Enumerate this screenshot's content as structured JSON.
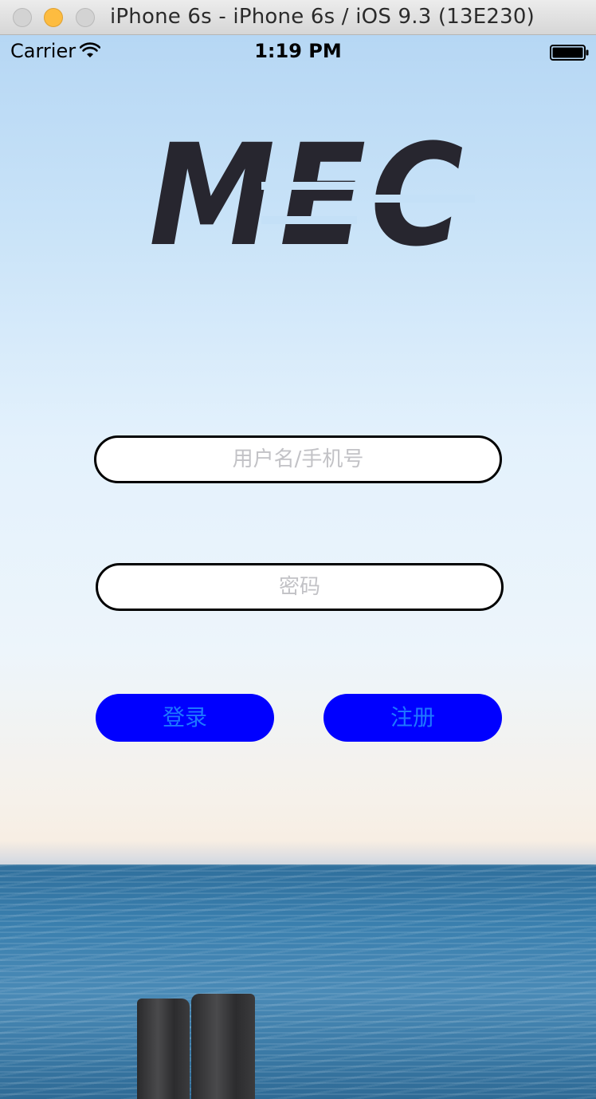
{
  "window": {
    "title": "iPhone 6s - iPhone 6s / iOS 9.3 (13E230)"
  },
  "statusbar": {
    "carrier": "Carrier",
    "time": "1:19 PM",
    "wifi_icon": "wifi-icon",
    "battery_icon": "battery-icon"
  },
  "logo": {
    "text": "MEC",
    "color": "#27262f"
  },
  "form": {
    "username_placeholder": "用户名/手机号",
    "password_placeholder": "密码",
    "login_label": "登录",
    "register_label": "注册"
  },
  "colors": {
    "button_bg": "#0000ff",
    "button_text": "#1e78ff",
    "field_border": "#000000",
    "placeholder": "#c2c2c6"
  }
}
